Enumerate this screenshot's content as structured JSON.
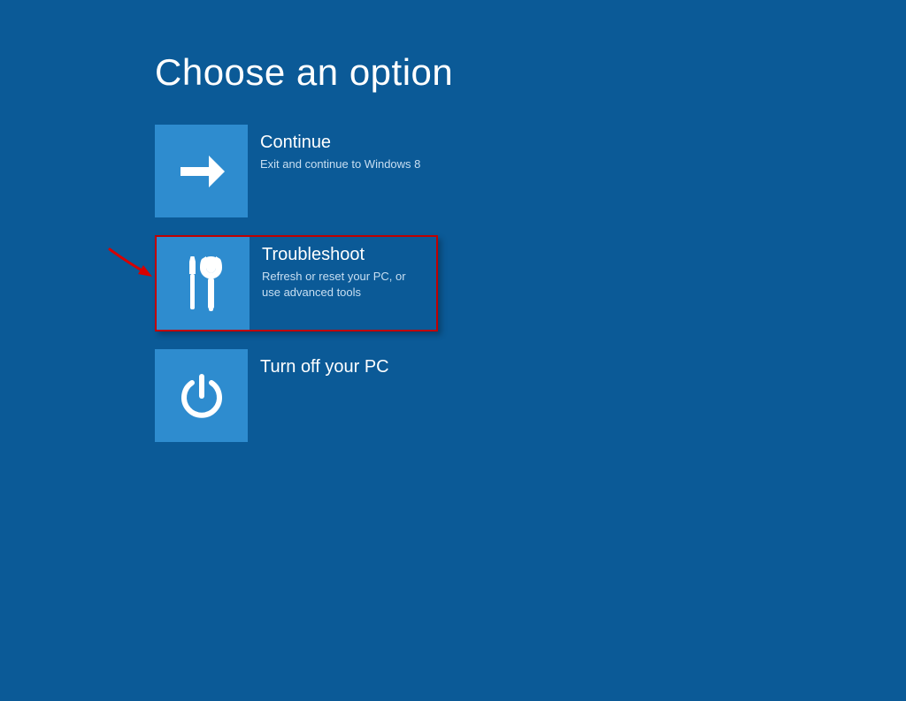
{
  "page": {
    "title": "Choose an option"
  },
  "options": {
    "continue": {
      "title": "Continue",
      "desc": "Exit and continue to Windows 8"
    },
    "troubleshoot": {
      "title": "Troubleshoot",
      "desc": "Refresh or reset your PC, or use advanced tools"
    },
    "turnoff": {
      "title": "Turn off your PC",
      "desc": ""
    }
  },
  "colors": {
    "bg": "#0b5a97",
    "tile": "#2e8ccf",
    "highlight": "#c00000"
  }
}
